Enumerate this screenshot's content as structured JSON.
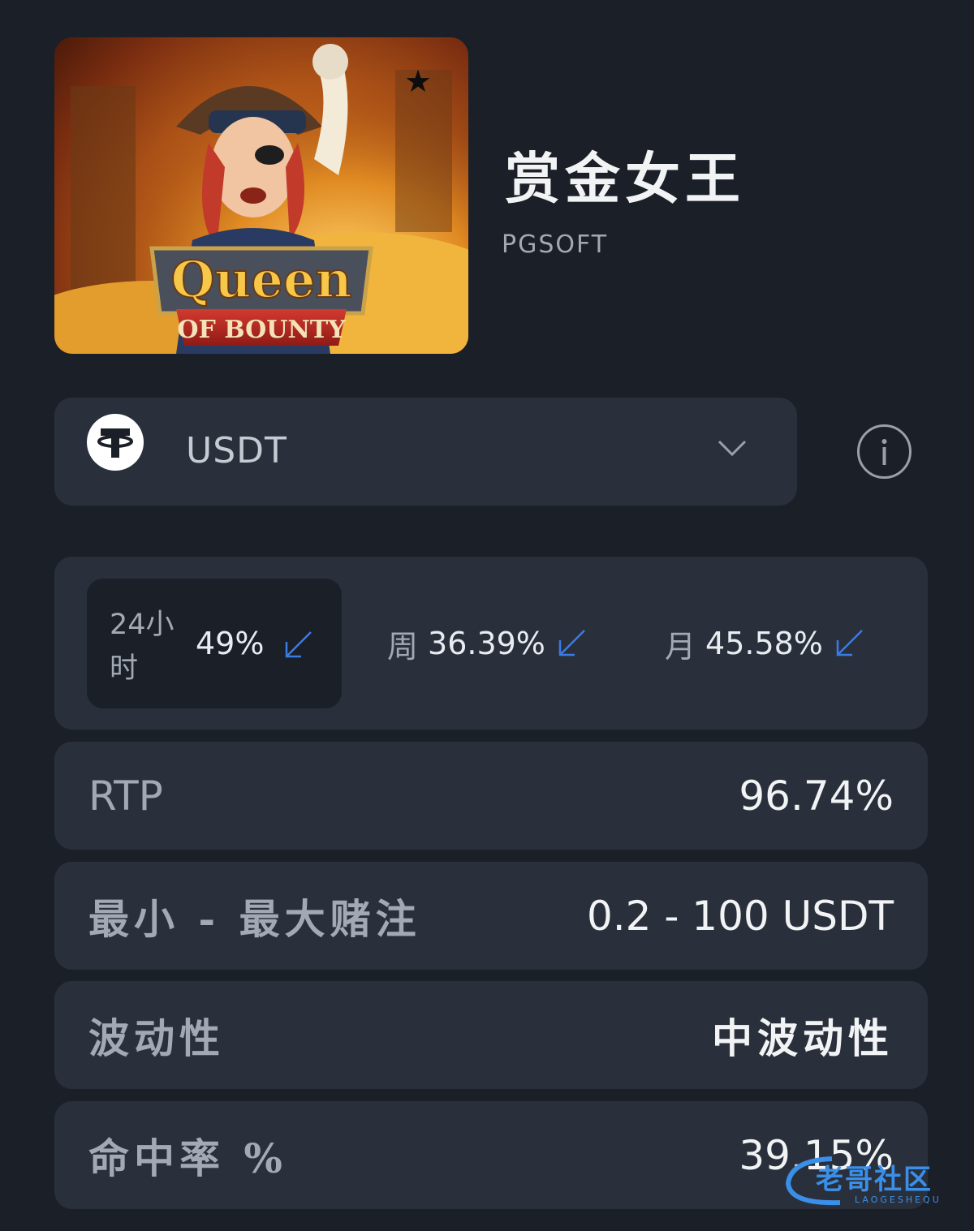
{
  "game": {
    "title": "赏金女王",
    "provider": "PGSOFT",
    "thumbnail_alt": "Queen of Bounty",
    "favorite_icon": "star-icon"
  },
  "currency": {
    "selected": "USDT",
    "icon": "tether-icon",
    "dropdown_icon": "chevron-down-icon",
    "info_icon": "info-icon"
  },
  "periods": [
    {
      "label": "24小时",
      "value": "49%",
      "trend_icon": "arrow-down-left-icon"
    },
    {
      "label": "周",
      "value": "36.39%",
      "trend_icon": "arrow-down-left-icon"
    },
    {
      "label": "月",
      "value": "45.58%",
      "trend_icon": "arrow-down-left-icon"
    }
  ],
  "stats": {
    "rtp": {
      "label": "RTP",
      "value": "96.74%"
    },
    "bet": {
      "label": "最小 - 最大赌注",
      "value": "0.2 - 100 USDT"
    },
    "volatility": {
      "label": "波动性",
      "value": "中波动性"
    },
    "hit_rate": {
      "label": "命中率 %",
      "value": "39.15%"
    }
  },
  "watermark": {
    "text": "老哥社区",
    "sub": "LAOGESHEQU"
  },
  "colors": {
    "background": "#1b1f27",
    "card": "#2a303b",
    "trend_arrow": "#3b7be8",
    "text_muted": "#a3a9b4",
    "text_primary": "#f2f3f5"
  }
}
